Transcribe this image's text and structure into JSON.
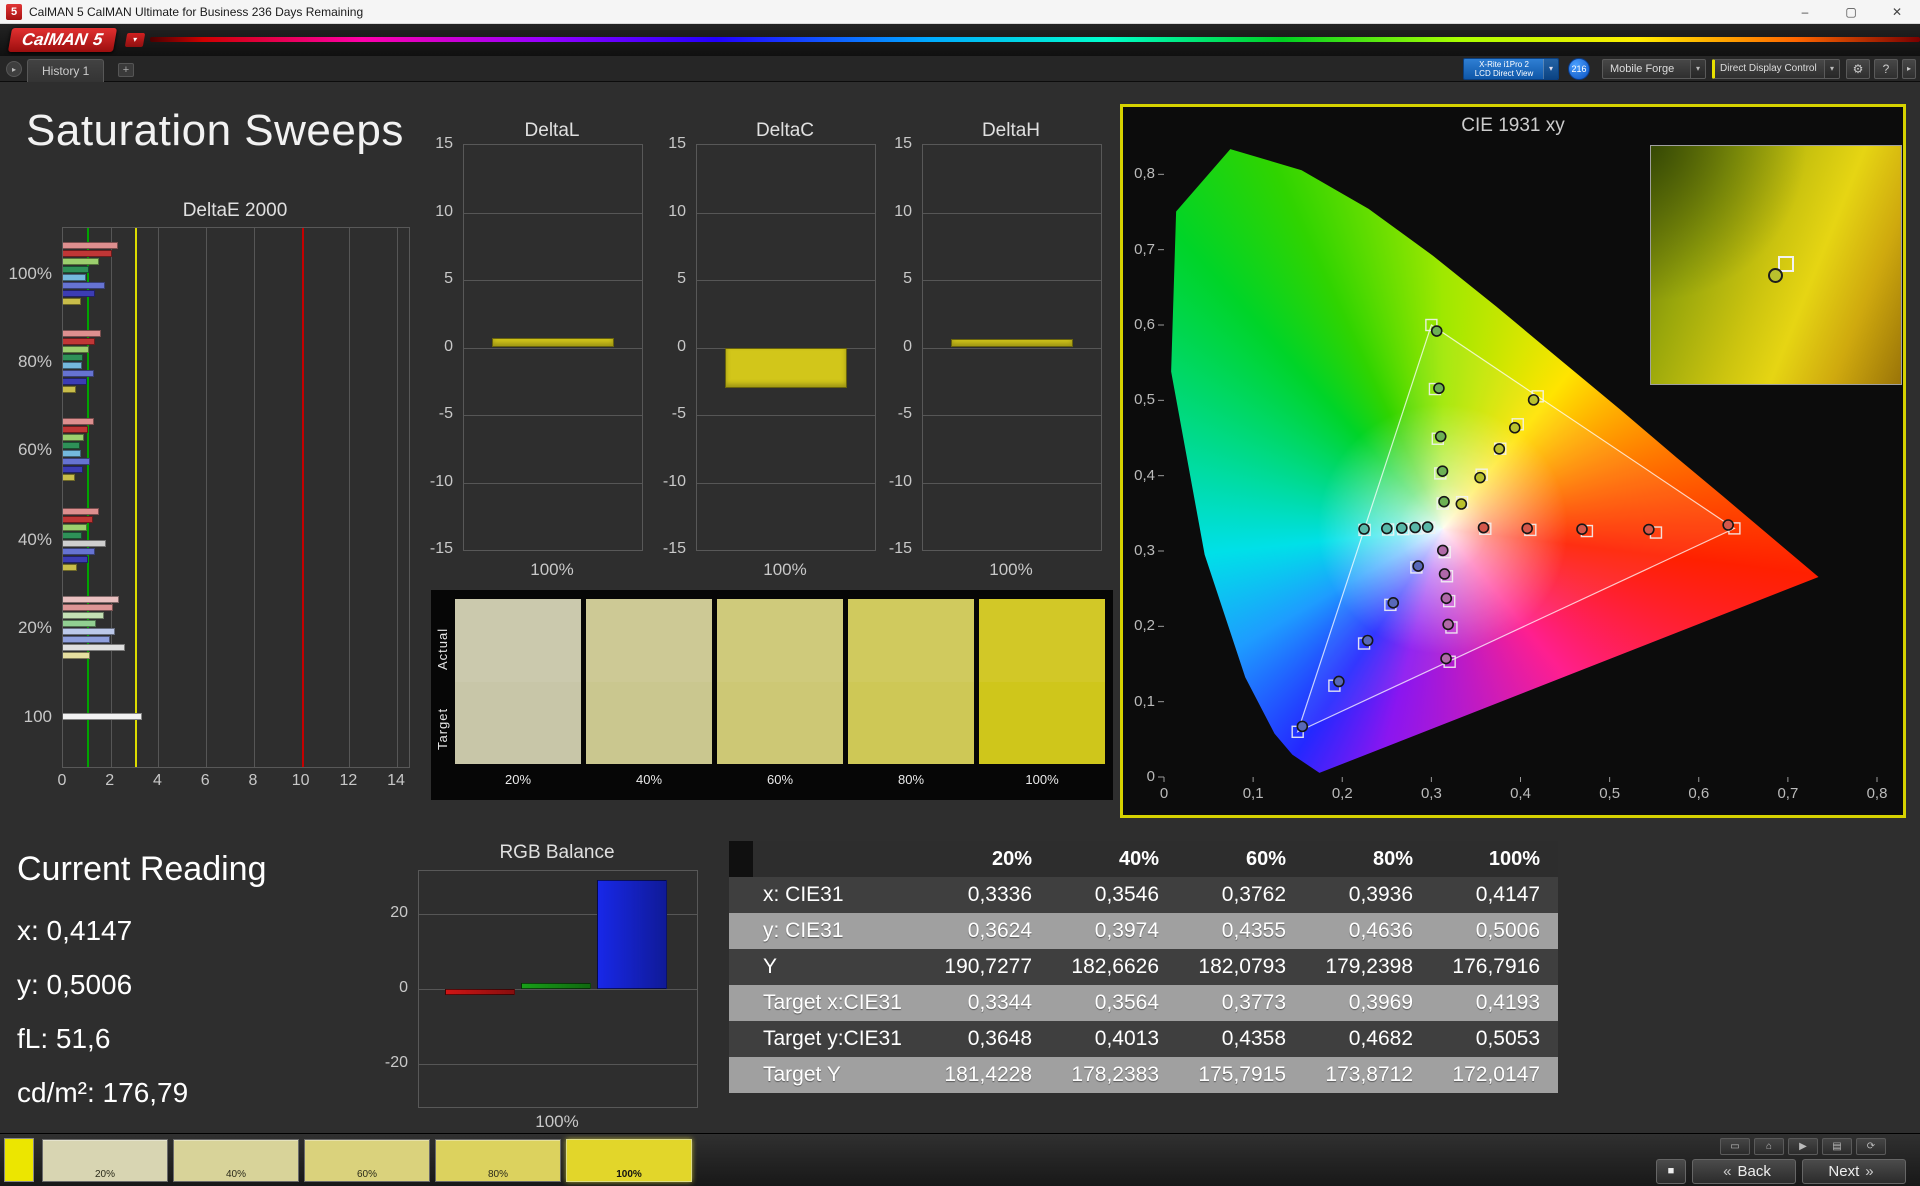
{
  "window": {
    "icon_label": "5",
    "title": "CalMAN 5 CalMAN Ultimate for Business 236 Days Remaining"
  },
  "icons": {
    "minimize": "–",
    "maximize": "▢",
    "close": "✕",
    "dropdown": "▾",
    "tab_arrow": "▸",
    "add_tab": "+",
    "gear": "⚙",
    "help": "?",
    "stop": "■",
    "back_chevrons": "«",
    "next_chevrons": "»"
  },
  "logo": {
    "text": "CalMAN",
    "version": "5"
  },
  "tabs": {
    "history": "History 1"
  },
  "toolbar": {
    "meter_line1": "X-Rite i1Pro 2",
    "meter_line2": "LCD Direct View",
    "badge": "216",
    "source": "Mobile Forge",
    "display_control": "Direct Display Control"
  },
  "page": {
    "title": "Saturation Sweeps"
  },
  "current_reading": {
    "title": "Current Reading",
    "items": [
      {
        "label": "x",
        "value": "0,4147"
      },
      {
        "label": "y",
        "value": "0,5006"
      },
      {
        "label": "fL",
        "value": "51,6"
      },
      {
        "label": "cd/m²",
        "value": "176,79"
      }
    ]
  },
  "swatch_comparison": {
    "actual_label": "Actual",
    "target_label": "Target",
    "steps": [
      {
        "label": "20%",
        "actual": "#cbc9ad",
        "target": "#c8c6a8"
      },
      {
        "label": "40%",
        "actual": "#cdc995",
        "target": "#cac78f"
      },
      {
        "label": "60%",
        "actual": "#cfca7b",
        "target": "#cdc875"
      },
      {
        "label": "80%",
        "actual": "#d0ca5e",
        "target": "#cec856"
      },
      {
        "label": "100%",
        "actual": "#d2c827",
        "target": "#cfc61b"
      }
    ]
  },
  "bottom_bar": {
    "tile_color": "#ece600",
    "steps": [
      {
        "label": "20%",
        "color": "#d8d5b2",
        "selected": false
      },
      {
        "label": "40%",
        "color": "#d8d399",
        "selected": false
      },
      {
        "label": "60%",
        "color": "#dad27c",
        "selected": false
      },
      {
        "label": "80%",
        "color": "#dcd25e",
        "selected": false
      },
      {
        "label": "100%",
        "color": "#e2d62a",
        "selected": true
      }
    ],
    "small_buttons": [
      {
        "name": "screen-icon",
        "glyph": "▭"
      },
      {
        "name": "home-icon",
        "glyph": "⌂"
      },
      {
        "name": "play-icon",
        "glyph": "▶"
      },
      {
        "name": "save-icon",
        "glyph": "▤"
      },
      {
        "name": "sync-icon",
        "glyph": "⟳"
      }
    ],
    "back_label": "Back",
    "next_label": "Next"
  },
  "chart_data": [
    {
      "id": "deltae2000",
      "type": "bar",
      "orientation": "horizontal",
      "title": "DeltaE 2000",
      "xlim": [
        0,
        14.5
      ],
      "xticks": [
        0,
        2,
        4,
        6,
        8,
        10,
        12,
        14
      ],
      "ref_lines": [
        {
          "value": 1,
          "color": "#00a400"
        },
        {
          "value": 3,
          "color": "#dcdc00"
        },
        {
          "value": 10,
          "color": "#c40000"
        }
      ],
      "groups": [
        {
          "label": "100%",
          "bars": [
            {
              "color": "#de8f8f",
              "value": 2.3
            },
            {
              "color": "#c03636",
              "value": 2.05
            },
            {
              "color": "#9ccf6e",
              "value": 1.5
            },
            {
              "color": "#2e9158",
              "value": 1.1
            },
            {
              "color": "#74b9dd",
              "value": 0.95
            },
            {
              "color": "#6673d2",
              "value": 1.75
            },
            {
              "color": "#3c3cb4",
              "value": 1.35
            },
            {
              "color": "#c9bd4a",
              "value": 0.75
            }
          ]
        },
        {
          "label": "80%",
          "bars": [
            {
              "color": "#de8f8f",
              "value": 1.6
            },
            {
              "color": "#c03636",
              "value": 1.35
            },
            {
              "color": "#9ccf6e",
              "value": 1.1
            },
            {
              "color": "#2e9158",
              "value": 0.85
            },
            {
              "color": "#74b9dd",
              "value": 0.8
            },
            {
              "color": "#6673d2",
              "value": 1.3
            },
            {
              "color": "#3c3cb4",
              "value": 1.0
            },
            {
              "color": "#c9bd4a",
              "value": 0.55
            }
          ]
        },
        {
          "label": "60%",
          "bars": [
            {
              "color": "#de8f8f",
              "value": 1.3
            },
            {
              "color": "#c03636",
              "value": 1.05
            },
            {
              "color": "#9ccf6e",
              "value": 0.9
            },
            {
              "color": "#2e9158",
              "value": 0.7
            },
            {
              "color": "#74b9dd",
              "value": 0.75
            },
            {
              "color": "#6673d2",
              "value": 1.15
            },
            {
              "color": "#3c3cb4",
              "value": 0.85
            },
            {
              "color": "#c9bd4a",
              "value": 0.5
            }
          ]
        },
        {
          "label": "40%",
          "bars": [
            {
              "color": "#de8f8f",
              "value": 1.5
            },
            {
              "color": "#c03636",
              "value": 1.25
            },
            {
              "color": "#9ccf6e",
              "value": 1.0
            },
            {
              "color": "#2e9158",
              "value": 0.8
            },
            {
              "color": "#cfcfcf",
              "value": 1.8
            },
            {
              "color": "#6673d2",
              "value": 1.35
            },
            {
              "color": "#3c3cb4",
              "value": 1.05
            },
            {
              "color": "#c9bd4a",
              "value": 0.6
            }
          ]
        },
        {
          "label": "20%",
          "bars": [
            {
              "color": "#e9c0c0",
              "value": 2.35
            },
            {
              "color": "#dd9595",
              "value": 2.1
            },
            {
              "color": "#c4e0b4",
              "value": 1.7
            },
            {
              "color": "#92cf92",
              "value": 1.4
            },
            {
              "color": "#bcc9ea",
              "value": 2.2
            },
            {
              "color": "#8f9fdd",
              "value": 1.95
            },
            {
              "color": "#e0e0e0",
              "value": 2.6
            },
            {
              "color": "#e6dfa0",
              "value": 1.15
            }
          ]
        },
        {
          "label": "100",
          "bars": [
            {
              "color": "#f2f2f2",
              "value": 3.3
            }
          ]
        }
      ]
    },
    {
      "id": "deltaL",
      "type": "bar",
      "title": "DeltaL",
      "xlabel": "100%",
      "ylim": [
        -15,
        15
      ],
      "yticks": [
        15,
        10,
        5,
        0,
        -5,
        -10,
        -15
      ],
      "bar_color": "#d2c61a",
      "value": 0.7
    },
    {
      "id": "deltaC",
      "type": "bar",
      "title": "DeltaC",
      "xlabel": "100%",
      "ylim": [
        -15,
        15
      ],
      "yticks": [
        15,
        10,
        5,
        0,
        -5,
        -10,
        -15
      ],
      "bar_color": "#d2c61a",
      "value": -3.0
    },
    {
      "id": "deltaH",
      "type": "bar",
      "title": "DeltaH",
      "xlabel": "100%",
      "ylim": [
        -15,
        15
      ],
      "yticks": [
        15,
        10,
        5,
        0,
        -5,
        -10,
        -15
      ],
      "bar_color": "#d2c61a",
      "value": 0.6
    },
    {
      "id": "rgb_balance",
      "type": "bar",
      "title": "RGB Balance",
      "xlabel": "100%",
      "ylim": [
        -31.5,
        31.5
      ],
      "yticks": [
        20,
        0,
        -20
      ],
      "series": [
        {
          "name": "Red",
          "value": -1.5,
          "color": "#d01515"
        },
        {
          "name": "Green",
          "value": 1.6,
          "color": "#18a018"
        },
        {
          "name": "Blue",
          "value": 29.0,
          "color": "#1828e8"
        }
      ]
    },
    {
      "id": "cie1931",
      "type": "scatter",
      "title": "CIE 1931 xy",
      "xlim": [
        0,
        0.8
      ],
      "ylim": [
        0,
        0.9
      ],
      "xticks": [
        [
          0,
          "0"
        ],
        [
          0.1,
          "0,1"
        ],
        [
          0.2,
          "0,2"
        ],
        [
          0.3,
          "0,3"
        ],
        [
          0.4,
          "0,4"
        ],
        [
          0.5,
          "0,5"
        ],
        [
          0.6,
          "0,6"
        ],
        [
          0.7,
          "0,7"
        ],
        [
          0.8,
          "0,8"
        ]
      ],
      "yticks": [
        [
          0.8,
          "0,8"
        ],
        [
          0.7,
          "0,7"
        ],
        [
          0.6,
          "0,6"
        ],
        [
          0.5,
          "0,5"
        ],
        [
          0.4,
          "0,4"
        ],
        [
          0.3,
          "0,3"
        ],
        [
          0.2,
          "0,2"
        ],
        [
          0.1,
          "0,1"
        ],
        [
          0,
          "0"
        ]
      ],
      "white_point": [
        0.3127,
        0.329
      ],
      "gamut_triangle": [
        [
          0.64,
          0.33
        ],
        [
          0.3,
          0.6
        ],
        [
          0.15,
          0.06
        ]
      ],
      "sweeps": [
        {
          "name": "yellow",
          "color": "#b9c12d",
          "targets": [
            [
              0.3344,
              0.3648
            ],
            [
              0.3564,
              0.4013
            ],
            [
              0.3773,
              0.4358
            ],
            [
              0.3969,
              0.4682
            ],
            [
              0.4193,
              0.5053
            ]
          ],
          "measured": [
            [
              0.3336,
              0.3624
            ],
            [
              0.3546,
              0.3974
            ],
            [
              0.3762,
              0.4355
            ],
            [
              0.3936,
              0.4636
            ],
            [
              0.4147,
              0.5006
            ]
          ]
        },
        {
          "name": "red",
          "color": "#d4574a",
          "targets": [
            [
              0.3605,
              0.3295
            ],
            [
              0.411,
              0.328
            ],
            [
              0.4745,
              0.3265
            ],
            [
              0.552,
              0.3245
            ],
            [
              0.64,
              0.33
            ]
          ],
          "measured": [
            [
              0.3585,
              0.331
            ],
            [
              0.4075,
              0.33
            ],
            [
              0.469,
              0.329
            ],
            [
              0.544,
              0.3285
            ],
            [
              0.633,
              0.3345
            ]
          ]
        },
        {
          "name": "green",
          "color": "#6cb054",
          "targets": [
            [
              0.3127,
              0.363
            ],
            [
              0.31,
              0.403
            ],
            [
              0.3072,
              0.449
            ],
            [
              0.304,
              0.515
            ],
            [
              0.3,
              0.6
            ]
          ],
          "measured": [
            [
              0.3142,
              0.3655
            ],
            [
              0.3125,
              0.406
            ],
            [
              0.3105,
              0.452
            ],
            [
              0.3085,
              0.516
            ],
            [
              0.306,
              0.592
            ]
          ]
        },
        {
          "name": "cyan",
          "color": "#58b8a8",
          "targets": [
            [
              0.2975,
              0.331
            ],
            [
              0.2835,
              0.33
            ],
            [
              0.2685,
              0.329
            ],
            [
              0.2515,
              0.3285
            ],
            [
              0.225,
              0.328
            ]
          ],
          "measured": [
            [
              0.2958,
              0.3318
            ],
            [
              0.2818,
              0.3312
            ],
            [
              0.2668,
              0.3305
            ],
            [
              0.25,
              0.3298
            ],
            [
              0.2245,
              0.3292
            ]
          ]
        },
        {
          "name": "magenta",
          "color": "#b068a8",
          "targets": [
            [
              0.315,
              0.2985
            ],
            [
              0.3175,
              0.2665
            ],
            [
              0.32,
              0.2335
            ],
            [
              0.3225,
              0.1985
            ],
            [
              0.3205,
              0.153
            ]
          ],
          "measured": [
            [
              0.3128,
              0.3008
            ],
            [
              0.3148,
              0.2695
            ],
            [
              0.3168,
              0.2372
            ],
            [
              0.3188,
              0.2025
            ],
            [
              0.3165,
              0.1572
            ]
          ]
        },
        {
          "name": "blue",
          "color": "#5868b8",
          "targets": [
            [
              0.2832,
              0.2782
            ],
            [
              0.254,
              0.2285
            ],
            [
              0.2245,
              0.1772
            ],
            [
              0.1912,
              0.1212
            ],
            [
              0.15,
              0.06
            ]
          ],
          "measured": [
            [
              0.2852,
              0.28
            ],
            [
              0.2572,
              0.2312
            ],
            [
              0.2285,
              0.1812
            ],
            [
              0.1962,
              0.1268
            ],
            [
              0.1552,
              0.0672
            ]
          ]
        }
      ],
      "inset": {
        "measured": [
          0.4147,
          0.5006
        ],
        "target": [
          0.4193,
          0.5053
        ]
      }
    },
    {
      "id": "measurements",
      "type": "table",
      "headers": [
        "",
        "20%",
        "40%",
        "60%",
        "80%",
        "100%"
      ],
      "rows": [
        {
          "label": "x: CIE31",
          "values": [
            "0,3336",
            "0,3546",
            "0,3762",
            "0,3936",
            "0,4147"
          ]
        },
        {
          "label": "y: CIE31",
          "values": [
            "0,3624",
            "0,3974",
            "0,4355",
            "0,4636",
            "0,5006"
          ]
        },
        {
          "label": "Y",
          "values": [
            "190,7277",
            "182,6626",
            "182,0793",
            "179,2398",
            "176,7916"
          ]
        },
        {
          "label": "Target x:CIE31",
          "values": [
            "0,3344",
            "0,3564",
            "0,3773",
            "0,3969",
            "0,4193"
          ]
        },
        {
          "label": "Target y:CIE31",
          "values": [
            "0,3648",
            "0,4013",
            "0,4358",
            "0,4682",
            "0,5053"
          ]
        },
        {
          "label": "Target Y",
          "values": [
            "181,4228",
            "178,2383",
            "175,7915",
            "173,8712",
            "172,0147"
          ]
        }
      ]
    }
  ]
}
